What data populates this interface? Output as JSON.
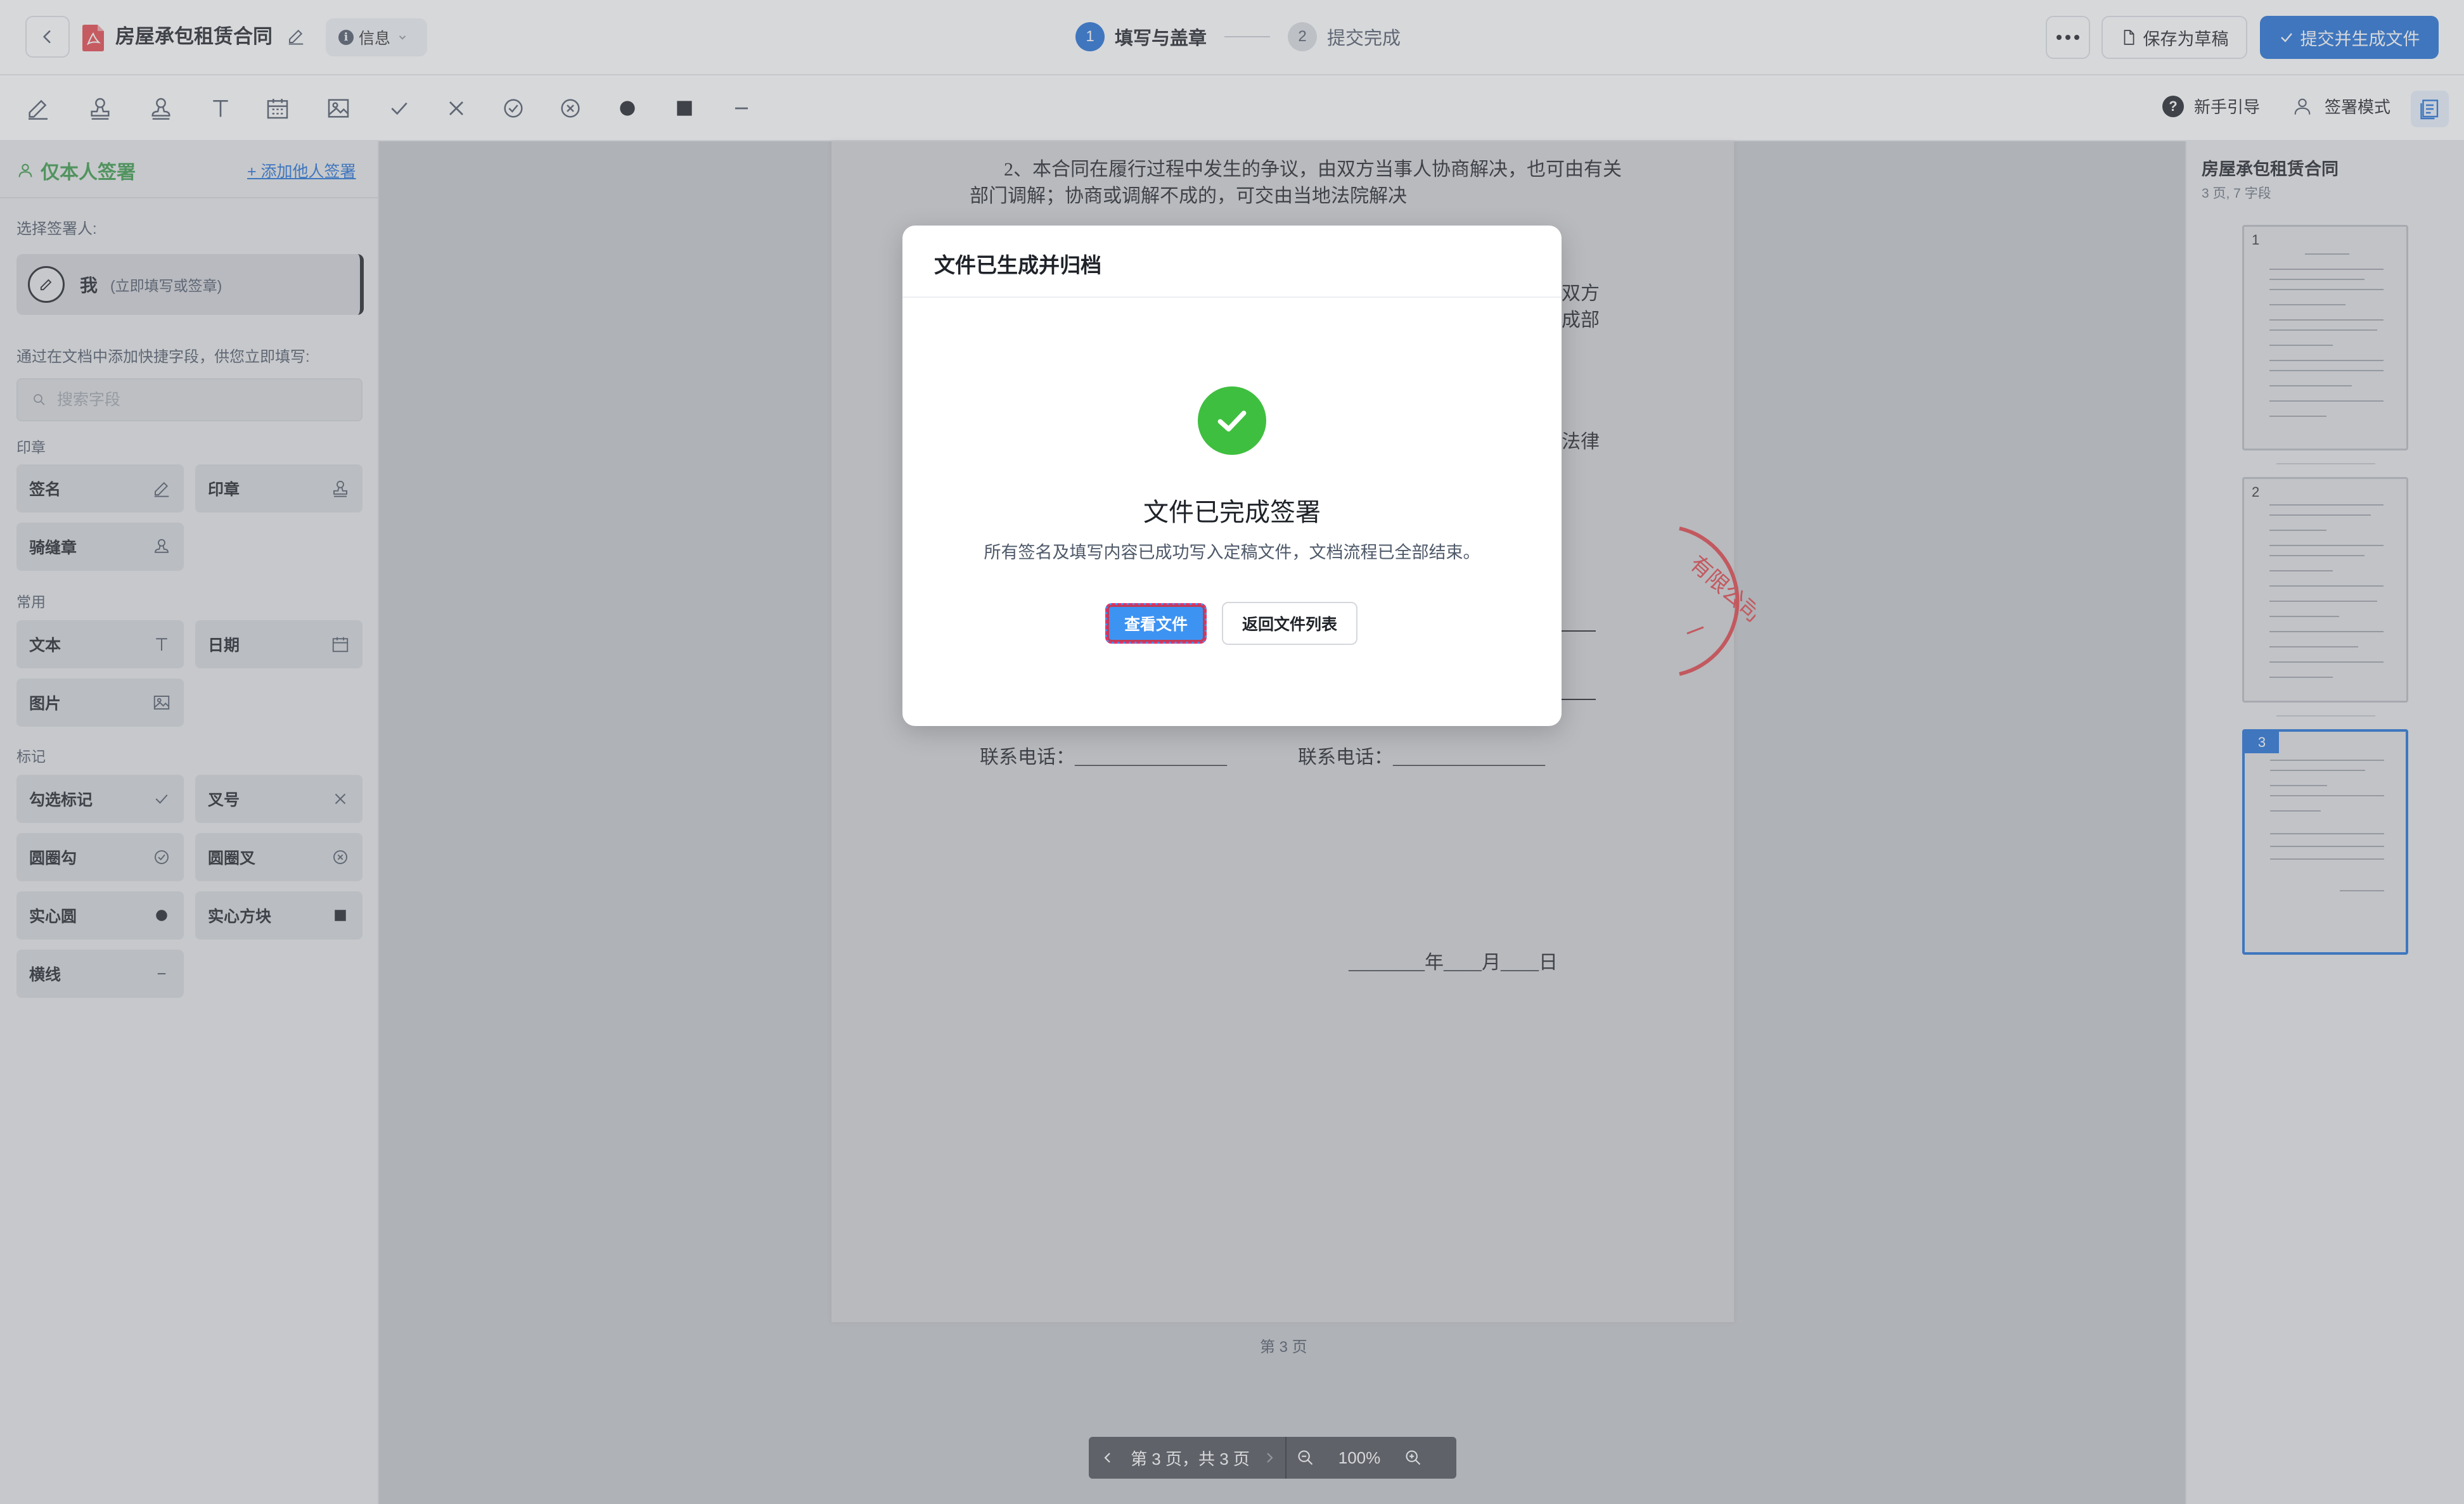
{
  "header": {
    "doc_title": "房屋承包租赁合同",
    "info_label": "信息",
    "steps": [
      {
        "num": "1",
        "label": "填写与盖章"
      },
      {
        "num": "2",
        "label": "提交完成"
      }
    ],
    "save_draft_label": "保存为草稿",
    "submit_label": "提交并生成文件"
  },
  "toolbar": {
    "tools": [
      "pen-icon",
      "stamp-icon",
      "seam-stamp-icon",
      "text-icon",
      "calendar-icon",
      "image-icon",
      "check-icon",
      "cross-icon",
      "circle-check-icon",
      "circle-cross-icon",
      "filled-circle-icon",
      "filled-square-icon",
      "line-icon"
    ],
    "guide_label": "新手引导",
    "mode_label": "签署模式"
  },
  "left_panel": {
    "title": "仅本人签署",
    "add_signer": "+ 添加他人签署",
    "select_signer_label": "选择签署人:",
    "signer_name": "我",
    "signer_hint": "(立即填写或签章)",
    "instruction": "通过在文档中添加快捷字段，供您立即填写:",
    "search_placeholder": "搜索字段",
    "sections": {
      "seal": "印章",
      "common": "常用",
      "mark": "标记"
    },
    "fields": {
      "signature": "签名",
      "seal": "印章",
      "seam_seal": "骑缝章",
      "text": "文本",
      "date": "日期",
      "image": "图片",
      "check": "勾选标记",
      "cross": "叉号",
      "circle_check": "圆圈勾",
      "circle_cross": "圆圈叉",
      "solid_circle": "实心圆",
      "solid_square": "实心方块",
      "line": "横线"
    }
  },
  "document": {
    "para1_line1": "2、本合同在履行过程中发生的争议，由双方当事人协商解决，也可由有关",
    "para1_line2": "部门调解；协商或调解不成的，可交由当地法院解决",
    "frag_a": "双方",
    "frag_b": "成部",
    "frag_c": "法律",
    "phone_left": "联系电话：________________",
    "phone_right": "联系电话：________________",
    "date_line": "________年____月____日",
    "stamp_text": "有限公司",
    "page_label": "第 3 页"
  },
  "pager": {
    "page_text": "第 3 页，共 3 页",
    "zoom": "100%"
  },
  "right_panel": {
    "title": "房屋承包租赁合同",
    "subtitle": "3 页, 7 字段",
    "thumbs": [
      "1",
      "2",
      "3"
    ]
  },
  "modal": {
    "title": "文件已生成并归档",
    "heading": "文件已完成签署",
    "message": "所有签名及填写内容已成功写入定稿文件，文档流程已全部结束。",
    "view_btn": "查看文件",
    "back_btn": "返回文件列表"
  }
}
